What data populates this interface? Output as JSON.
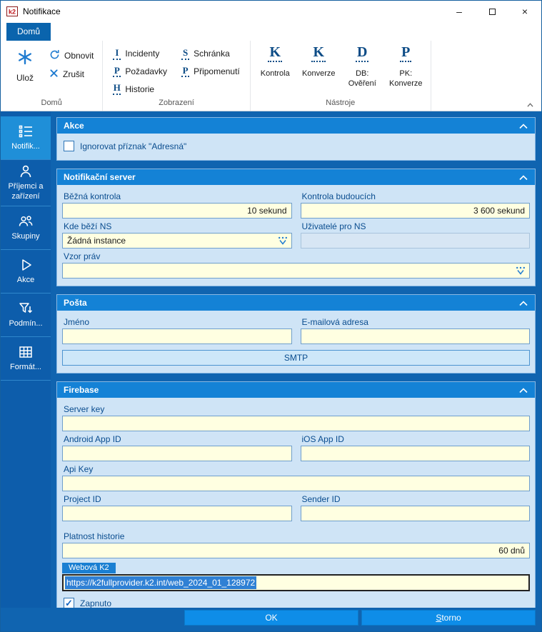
{
  "window": {
    "title": "Notifikace",
    "icons": {
      "minimize": "–",
      "close": "×"
    }
  },
  "ribbon": {
    "tab_home": "Domů",
    "home": {
      "label": "Domů",
      "save": "Ulož",
      "refresh": "Obnovit",
      "cancel": "Zrušit"
    },
    "view": {
      "label": "Zobrazení",
      "items": [
        {
          "letter": "I",
          "text": "Incidenty"
        },
        {
          "letter": "P",
          "text": "Požadavky"
        },
        {
          "letter": "H",
          "text": "Historie"
        },
        {
          "letter": "S",
          "text": "Schránka"
        },
        {
          "letter": "P",
          "text": "Připomenutí"
        }
      ]
    },
    "tools": {
      "label": "Nástroje",
      "items": [
        {
          "letter": "K",
          "line1": "Kontrola",
          "line2": ""
        },
        {
          "letter": "K",
          "line1": "Konverze",
          "line2": ""
        },
        {
          "letter": "D",
          "line1": "DB:",
          "line2": "Ověření"
        },
        {
          "letter": "P",
          "line1": "PK:",
          "line2": "Konverze"
        }
      ]
    }
  },
  "sidebar": {
    "items": [
      {
        "label": "Notifik..."
      },
      {
        "label": "Příjemci a zařízení"
      },
      {
        "label": "Skupiny"
      },
      {
        "label": "Akce"
      },
      {
        "label": "Podmín..."
      },
      {
        "label": "Formát..."
      }
    ]
  },
  "sections": {
    "akce": {
      "title": "Akce",
      "ignore_label": "Ignorovat příznak \"Adresná\""
    },
    "server": {
      "title": "Notifikační server",
      "bezna_label": "Běžná kontrola",
      "bezna_value": "10 sekund",
      "budouci_label": "Kontrola budoucích",
      "budouci_value": "3 600 sekund",
      "kde_label": "Kde běží NS",
      "kde_value": "Žádná instance",
      "uzivatele_label": "Uživatelé pro NS",
      "uzivatele_value": "",
      "vzor_label": "Vzor práv",
      "vzor_value": ""
    },
    "posta": {
      "title": "Pošta",
      "jmeno_label": "Jméno",
      "jmeno_value": "",
      "email_label": "E-mailová adresa",
      "email_value": "",
      "smtp": "SMTP"
    },
    "firebase": {
      "title": "Firebase",
      "server_key_label": "Server key",
      "server_key_value": "",
      "android_label": "Android App ID",
      "android_value": "",
      "ios_label": "iOS App ID",
      "ios_value": "",
      "api_label": "Api Key",
      "api_value": "",
      "project_label": "Project ID",
      "project_value": "",
      "sender_label": "Sender ID",
      "sender_value": "",
      "platnost_label": "Platnost historie",
      "platnost_value": "60 dnů",
      "webova_label": "Webová K2",
      "webova_value": "https://k2fullprovider.k2.int/web_2024_01_128972",
      "zapnuto_label": "Zapnuto",
      "zapnuto_check": "✓"
    }
  },
  "footer": {
    "ok": "OK",
    "storno": "Storno"
  },
  "colors": {
    "accent_blue": "#1064b0",
    "section_header_blue": "#1482d6",
    "panel_bg": "#cfe4f6",
    "field_bg": "#ffffe1",
    "selection_blue": "#2f80d4",
    "button_blue": "#0e8de8",
    "sidebar_selected": "#1f8fd8",
    "tab_blue": "#0a64ad"
  }
}
